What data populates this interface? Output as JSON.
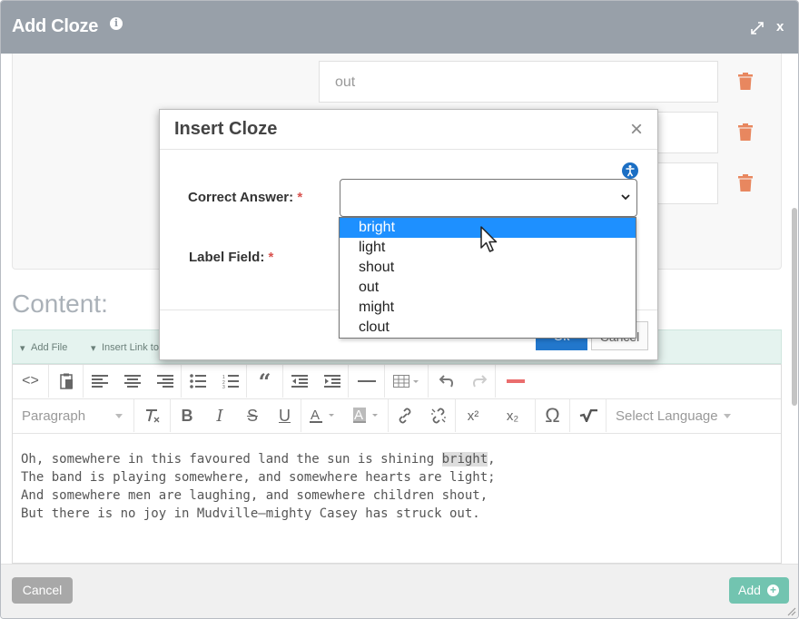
{
  "window": {
    "title": "Add Cloze",
    "info_icon": "info-icon",
    "expand_icon": "expand-icon",
    "close_label": "x"
  },
  "answers": [
    {
      "value": "out"
    },
    {
      "value": ""
    },
    {
      "value": ""
    }
  ],
  "content_label": "Content:",
  "attach_bar": {
    "add_file": "Add File",
    "insert_link": "Insert Link to"
  },
  "toolbar": {
    "format_select": "Paragraph",
    "language_select": "Select Language",
    "superscript_label": "x²",
    "subscript_label": "x₂",
    "omega_label": "Ω"
  },
  "editor": {
    "line1_before": "Oh, somewhere in this favoured land the sun is shining ",
    "line1_highlight": "bright",
    "line1_after": ",",
    "line2": "The band is playing somewhere, and somewhere hearts are light;",
    "line3": "And somewhere men are laughing, and somewhere children shout,",
    "line4": "But there is no joy in Mudville—mighty Casey has struck out."
  },
  "footer": {
    "cancel": "Cancel",
    "add": "Add"
  },
  "modal": {
    "title": "Insert Cloze",
    "close_glyph": "×",
    "correct_answer_label": "Correct Answer:",
    "label_field_label": "Label Field:",
    "required_mark": "*",
    "ok": "Ok",
    "cancel": "Cancel",
    "selected_value": ""
  },
  "dropdown": {
    "options": [
      "bright",
      "light",
      "shout",
      "out",
      "might",
      "clout"
    ],
    "highlighted": "bright"
  },
  "colors": {
    "titlebar": "#98a0a9",
    "accent_blue": "#1e90ff",
    "add_green": "#72c4b0",
    "trash_orange": "#e8875f",
    "required_red": "#d9534f"
  }
}
